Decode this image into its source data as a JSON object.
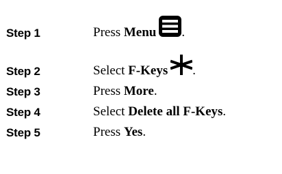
{
  "steps": [
    {
      "label": "Step 1",
      "prefix": "Press ",
      "emphasis": "Menu",
      "icon": "menu-icon",
      "suffix": "."
    },
    {
      "label": "Step 2",
      "prefix": "Select ",
      "emphasis": "F-Keys",
      "icon": "asterisk-icon",
      "suffix": "."
    },
    {
      "label": "Step 3",
      "prefix": "Press ",
      "emphasis": "More",
      "suffix": "."
    },
    {
      "label": "Step 4",
      "prefix": "Select ",
      "emphasis": "Delete all F-Keys",
      "suffix": "."
    },
    {
      "label": "Step 5",
      "prefix": "Press ",
      "emphasis": "Yes",
      "suffix": "."
    }
  ],
  "colors": {
    "text": "#000000",
    "background": "#ffffff",
    "icon": "#000000"
  }
}
